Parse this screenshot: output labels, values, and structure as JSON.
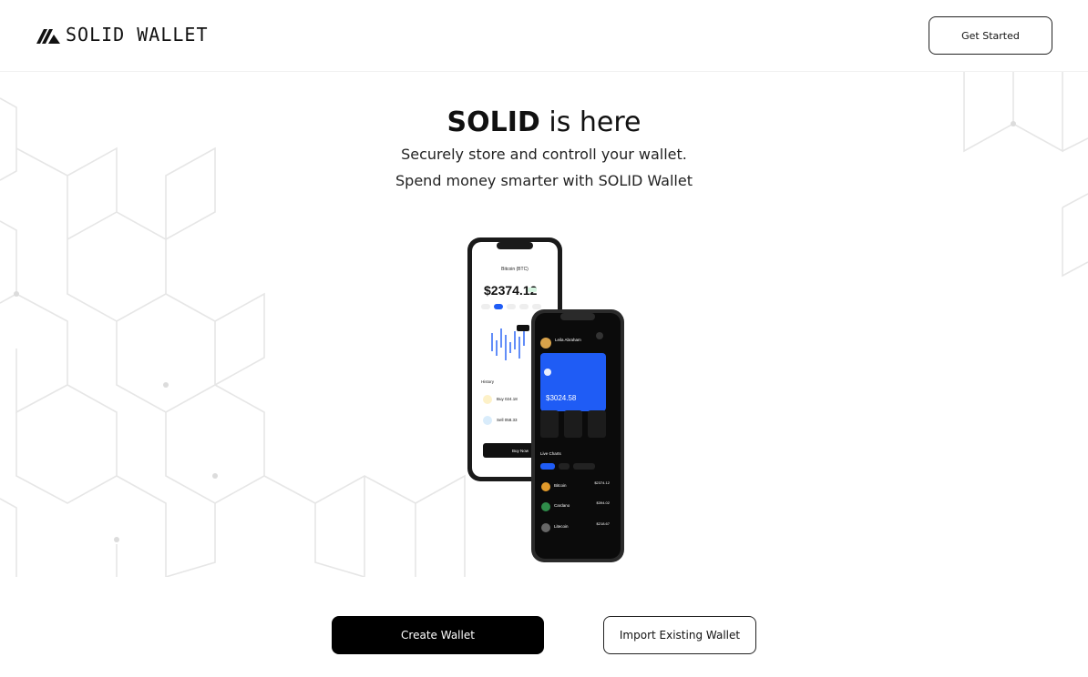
{
  "header": {
    "brand": "SOLID WALLET",
    "get_started_label": "Get Started"
  },
  "hero": {
    "title_bold": "SOLID",
    "title_rest": " is here",
    "line1": "Securely store and controll your wallet.",
    "line2": "Spend money smarter with SOLID Wallet"
  },
  "phone_front": {
    "coin_title": "Bitcoin (BTC)",
    "price": "$2374.12",
    "history_label": "History",
    "history_items": [
      "Buy 024.18",
      "Sell 058.33"
    ],
    "buy_button": "Buy Now"
  },
  "phone_back": {
    "user_name": "Leila Abraham",
    "card_balance": "$3024.58",
    "section_label": "Live Charts",
    "coins": [
      {
        "name": "Bitcoin",
        "value": "$2374.12"
      },
      {
        "name": "Cardano",
        "value": "$394.02"
      },
      {
        "name": "Litecoin",
        "value": "$218.67"
      }
    ]
  },
  "actions": {
    "create_label": "Create Wallet",
    "import_label": "Import Existing Wallet"
  },
  "colors": {
    "accent_blue": "#1f5cf5",
    "black": "#000000",
    "pattern_line": "#e4e4e4"
  }
}
